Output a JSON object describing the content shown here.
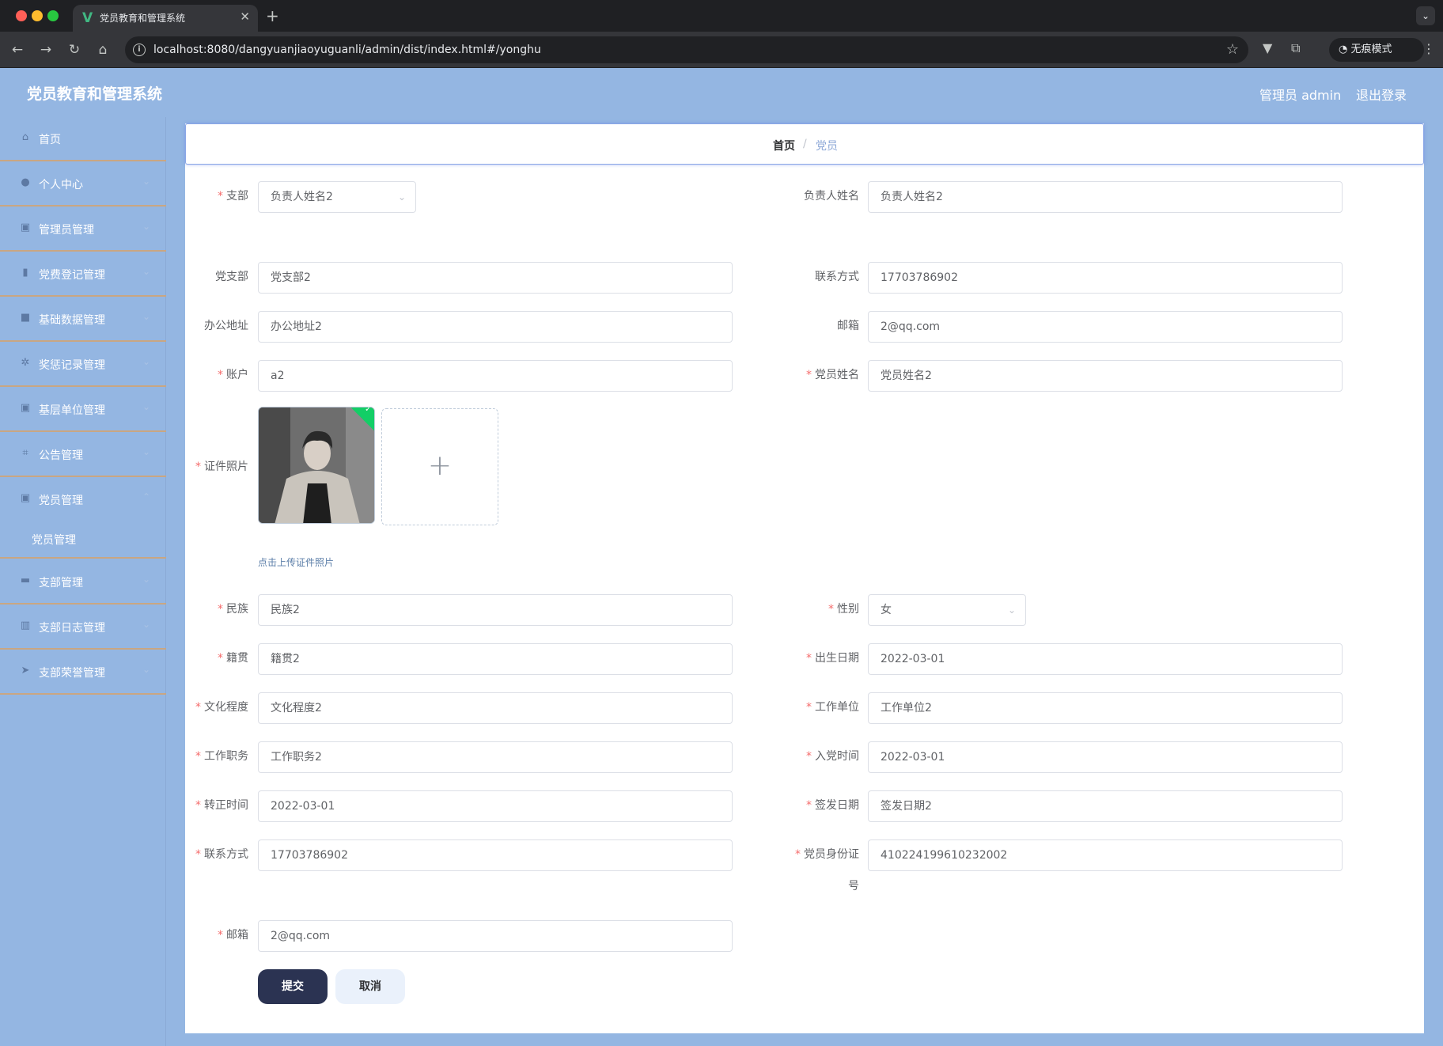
{
  "browser": {
    "tab_title": "党员教育和管理系统",
    "tab_favicon": "V",
    "url": "localhost:8080/dangyuanjiaoyuguanli/admin/dist/index.html#/yonghu",
    "incognito_label": "无痕模式"
  },
  "header": {
    "title": "党员教育和管理系统",
    "user": "管理员 admin",
    "logout": "退出登录"
  },
  "sidebar": {
    "items": [
      {
        "label": "首页",
        "icon": "home-icon"
      },
      {
        "label": "个人中心",
        "icon": "user-icon"
      },
      {
        "label": "管理员管理",
        "icon": "clipboard-icon"
      },
      {
        "label": "党费登记管理",
        "icon": "microphone-icon"
      },
      {
        "label": "基础数据管理",
        "icon": "briefcase-icon"
      },
      {
        "label": "奖惩记录管理",
        "icon": "aperture-icon"
      },
      {
        "label": "基层单位管理",
        "icon": "clipboard-icon"
      },
      {
        "label": "公告管理",
        "icon": "crop-icon"
      },
      {
        "label": "党员管理",
        "icon": "clipboard-icon"
      },
      {
        "label": "支部管理",
        "icon": "wallet-icon"
      },
      {
        "label": "支部日志管理",
        "icon": "books-icon"
      },
      {
        "label": "支部荣誉管理",
        "icon": "send-icon"
      }
    ],
    "submenu": {
      "label": "党员管理"
    }
  },
  "breadcrumb": {
    "home": "首页",
    "separator": "/",
    "current": "党员"
  },
  "form": {
    "branch": {
      "label": "支部",
      "value": "负责人姓名2"
    },
    "leader_name": {
      "label": "负责人姓名",
      "value": "负责人姓名2"
    },
    "party_branch": {
      "label": "党支部",
      "value": "党支部2"
    },
    "contact_top": {
      "label": "联系方式",
      "value": "17703786902"
    },
    "office_addr": {
      "label": "办公地址",
      "value": "办公地址2"
    },
    "email_top": {
      "label": "邮箱",
      "value": "2@qq.com"
    },
    "account": {
      "label": "账户",
      "value": "a2"
    },
    "member_name": {
      "label": "党员姓名",
      "value": "党员姓名2"
    },
    "photo": {
      "label": "证件照片",
      "tip": "点击上传证件照片"
    },
    "ethnicity": {
      "label": "民族",
      "value": "民族2"
    },
    "gender": {
      "label": "性别",
      "value": "女"
    },
    "native_place": {
      "label": "籍贯",
      "value": "籍贯2"
    },
    "birth_date": {
      "label": "出生日期",
      "value": "2022-03-01"
    },
    "education": {
      "label": "文化程度",
      "value": "文化程度2"
    },
    "work_unit": {
      "label": "工作单位",
      "value": "工作单位2"
    },
    "job_title": {
      "label": "工作职务",
      "value": "工作职务2"
    },
    "join_date": {
      "label": "入党时间",
      "value": "2022-03-01"
    },
    "formal_date": {
      "label": "转正时间",
      "value": "2022-03-01"
    },
    "issue_date": {
      "label": "签发日期",
      "value": "签发日期2"
    },
    "contact": {
      "label": "联系方式",
      "value": "17703786902"
    },
    "id_number": {
      "label": "党员身份证号",
      "value": "410224199610232002"
    },
    "email": {
      "label": "邮箱",
      "value": "2@qq.com"
    },
    "submit": "提交",
    "cancel": "取消"
  }
}
